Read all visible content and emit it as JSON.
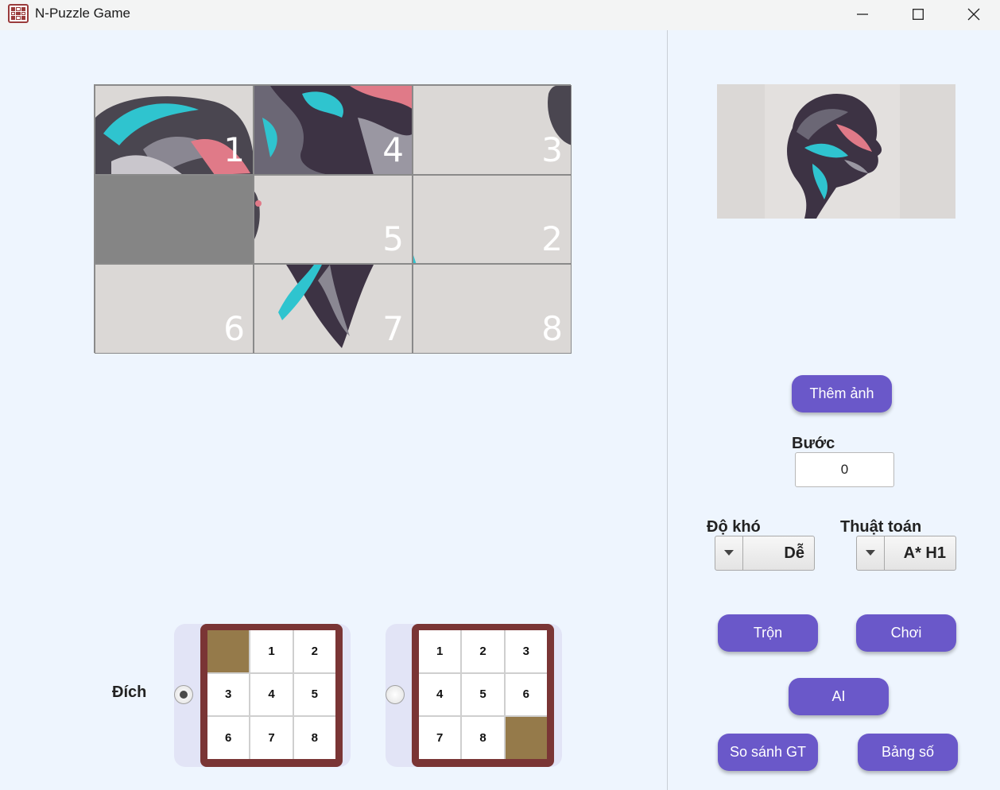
{
  "window": {
    "title": "N-Puzzle Game",
    "controls": [
      "minimize",
      "maximize",
      "close"
    ]
  },
  "board": {
    "rows": 3,
    "cols": 3,
    "tiles": [
      "1",
      "4",
      "3",
      "",
      "5",
      "2",
      "6",
      "7",
      "8"
    ]
  },
  "controls": {
    "add_image_label": "Thêm ảnh",
    "steps_label": "Bước",
    "steps_value": "0",
    "difficulty_label": "Độ khó",
    "difficulty_value": "Dễ",
    "algorithm_label": "Thuật toán",
    "algorithm_value": "A* H1",
    "shuffle_label": "Trộn",
    "play_label": "Chơi",
    "ai_label": "AI",
    "compare_label": "So sánh GT",
    "table_label": "Bảng số"
  },
  "goal": {
    "label": "Đích",
    "options": [
      {
        "selected": true,
        "cells": [
          "",
          "1",
          "2",
          "3",
          "4",
          "5",
          "6",
          "7",
          "8"
        ]
      },
      {
        "selected": false,
        "cells": [
          "1",
          "2",
          "3",
          "4",
          "5",
          "6",
          "7",
          "8",
          ""
        ]
      }
    ]
  },
  "colors": {
    "accent": "#6a58c9",
    "background": "#eef5fe",
    "goal_frame": "#7a3535",
    "blank_cell": "#957a4a",
    "empty_tile": "#858585"
  }
}
